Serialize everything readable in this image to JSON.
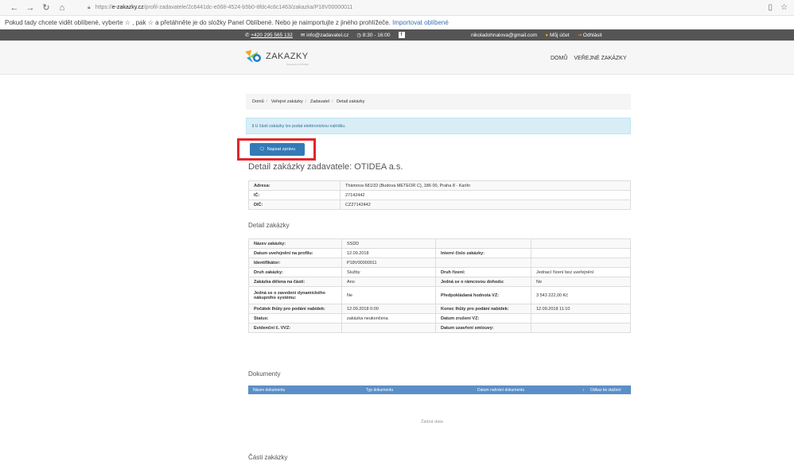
{
  "browser": {
    "url_prefix": "https://",
    "url_host": "e-zakazky.cz",
    "url_path": "/profil-zadavatele/2c6441dc-e068-4524-b5b0-8fdc4c8c1463/zakazka/P18V00000011"
  },
  "favbar": {
    "text": "Pokud tady chcete vidět oblíbené, vyberte ☆ , pak ☆ a přetáhněte je do složky Panel Oblíbené. Nebo je naimportujte z jiného prohlížeče.",
    "link": "Importovat oblíbené"
  },
  "topbar": {
    "phone": "+420 295 565 132",
    "email": "info@zadavatel.cz",
    "hours": "8:30 - 16:00",
    "user": "nikoladohnalova@gmail.com",
    "account": "Můj účet",
    "logout": "Odhlásit"
  },
  "header": {
    "logo_text": "ZAKAZKY",
    "logo_sub": "Powered by OTIDEA",
    "nav": [
      "DOMŮ",
      "VEŘEJNÉ ZAKÁZKY"
    ]
  },
  "breadcrumb": [
    "Domů",
    "Veřejné zakázky",
    "Zadavatel",
    "Detail zakázky"
  ],
  "alert": "ℹ U části zakázky lze podat elektronickou nabídku.",
  "message_button": "Napsat zprávu",
  "title": "Detail zakázky zadavatele: OTIDEA a.s.",
  "contractor": [
    {
      "label": "Adresa:",
      "value": "Thámova 681/32 (Budova METEOR C), 186 00, Praha 8 - Karlín"
    },
    {
      "label": "IČ:",
      "value": "27142442"
    },
    {
      "label": "DIČ:",
      "value": "CZ27142442"
    }
  ],
  "detail_heading": "Detail zakázky",
  "detail": [
    [
      "Název zakázky:",
      "SSDD",
      "",
      ""
    ],
    [
      "Datum uveřejnění na profilu:",
      "12.09.2018",
      "Interní číslo zakázky:",
      ""
    ],
    [
      "Identifikátor:",
      "P18V00000011",
      "",
      ""
    ],
    [
      "Druh zakázky:",
      "Služby",
      "Druh řízení:",
      "Jednací řízení bez uveřejnění"
    ],
    [
      "Zakázka dělena na části:",
      "Ano",
      "Jedná se o rámcovou dohodu:",
      "Ne"
    ],
    [
      "Jedná se o zavedení dynamického nákupního systému:",
      "Ne",
      "Předpokládaná hodnota VZ:",
      "3 543 222,00 Kč"
    ],
    [
      "Počátek lhůty pro podání nabídek:",
      "12.09.2018 0:00",
      "Konec lhůty pro podání nabídek:",
      "12.09.2018 11:10"
    ],
    [
      "Status:",
      "zakázka neukončena",
      "Datum zrušení VZ:",
      ""
    ],
    [
      "Evidenční č. VVZ:",
      "",
      "Datum uzavření smlouvy:",
      ""
    ]
  ],
  "documents": {
    "heading": "Dokumenty",
    "columns": [
      "Název dokumentu",
      "Typ dokumentu",
      "Datum nahrání dokumentu",
      "Odkaz ke stažení"
    ],
    "empty": "Žádná data"
  },
  "parts_heading": "Části zakázky",
  "colors": {
    "accent": "#337ab7",
    "highlight": "#e0262b",
    "table_head": "#5a8fc7"
  }
}
